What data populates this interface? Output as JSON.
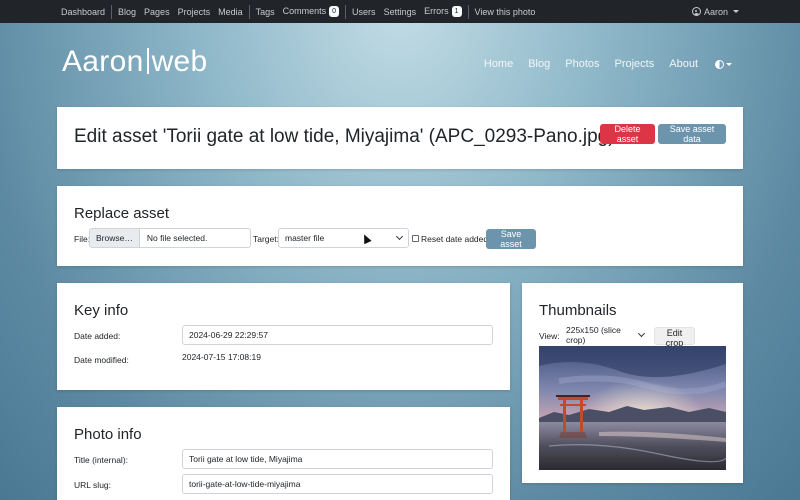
{
  "adminbar": {
    "links": [
      "Dashboard",
      "Blog",
      "Pages",
      "Projects",
      "Media",
      "Tags",
      "Comments",
      "Users",
      "Settings",
      "Errors",
      "View this photo"
    ],
    "comments_count": "0",
    "errors_count": "1",
    "user": "Aaron"
  },
  "site": {
    "title_left": "Aaron",
    "title_right": "web",
    "nav": [
      "Home",
      "Blog",
      "Photos",
      "Projects",
      "About"
    ]
  },
  "header_card": {
    "title": "Edit asset 'Torii gate at low tide, Miyajima' (APC_0293-Pano.jpg)",
    "delete_label": "Delete asset",
    "save_label": "Save asset data"
  },
  "replace_card": {
    "heading": "Replace asset",
    "file_label": "File:",
    "browse_label": "Browse…",
    "file_status": "No file selected.",
    "target_label": "Target:",
    "target_value": "master file",
    "reset_label": "Reset date added?",
    "save_label": "Save asset"
  },
  "key_info": {
    "heading": "Key info",
    "date_added_label": "Date added:",
    "date_added_value": "2024-06-29 22:29:57",
    "date_modified_label": "Date modified:",
    "date_modified_value": "2024-07-15 17:08:19"
  },
  "photo_info": {
    "heading": "Photo info",
    "title_label": "Title (internal):",
    "title_value": "Torii gate at low tide, Miyajima",
    "slug_label": "URL slug:",
    "slug_value": "torii-gate-at-low-tide-miyajima"
  },
  "thumbnails": {
    "heading": "Thumbnails",
    "view_label": "View:",
    "view_value": "225x150 (slice crop)",
    "edit_crop_label": "Edit crop"
  },
  "colors": {
    "danger": "#dc3545",
    "secondary": "#6c95ad",
    "adminbar": "#212529"
  }
}
